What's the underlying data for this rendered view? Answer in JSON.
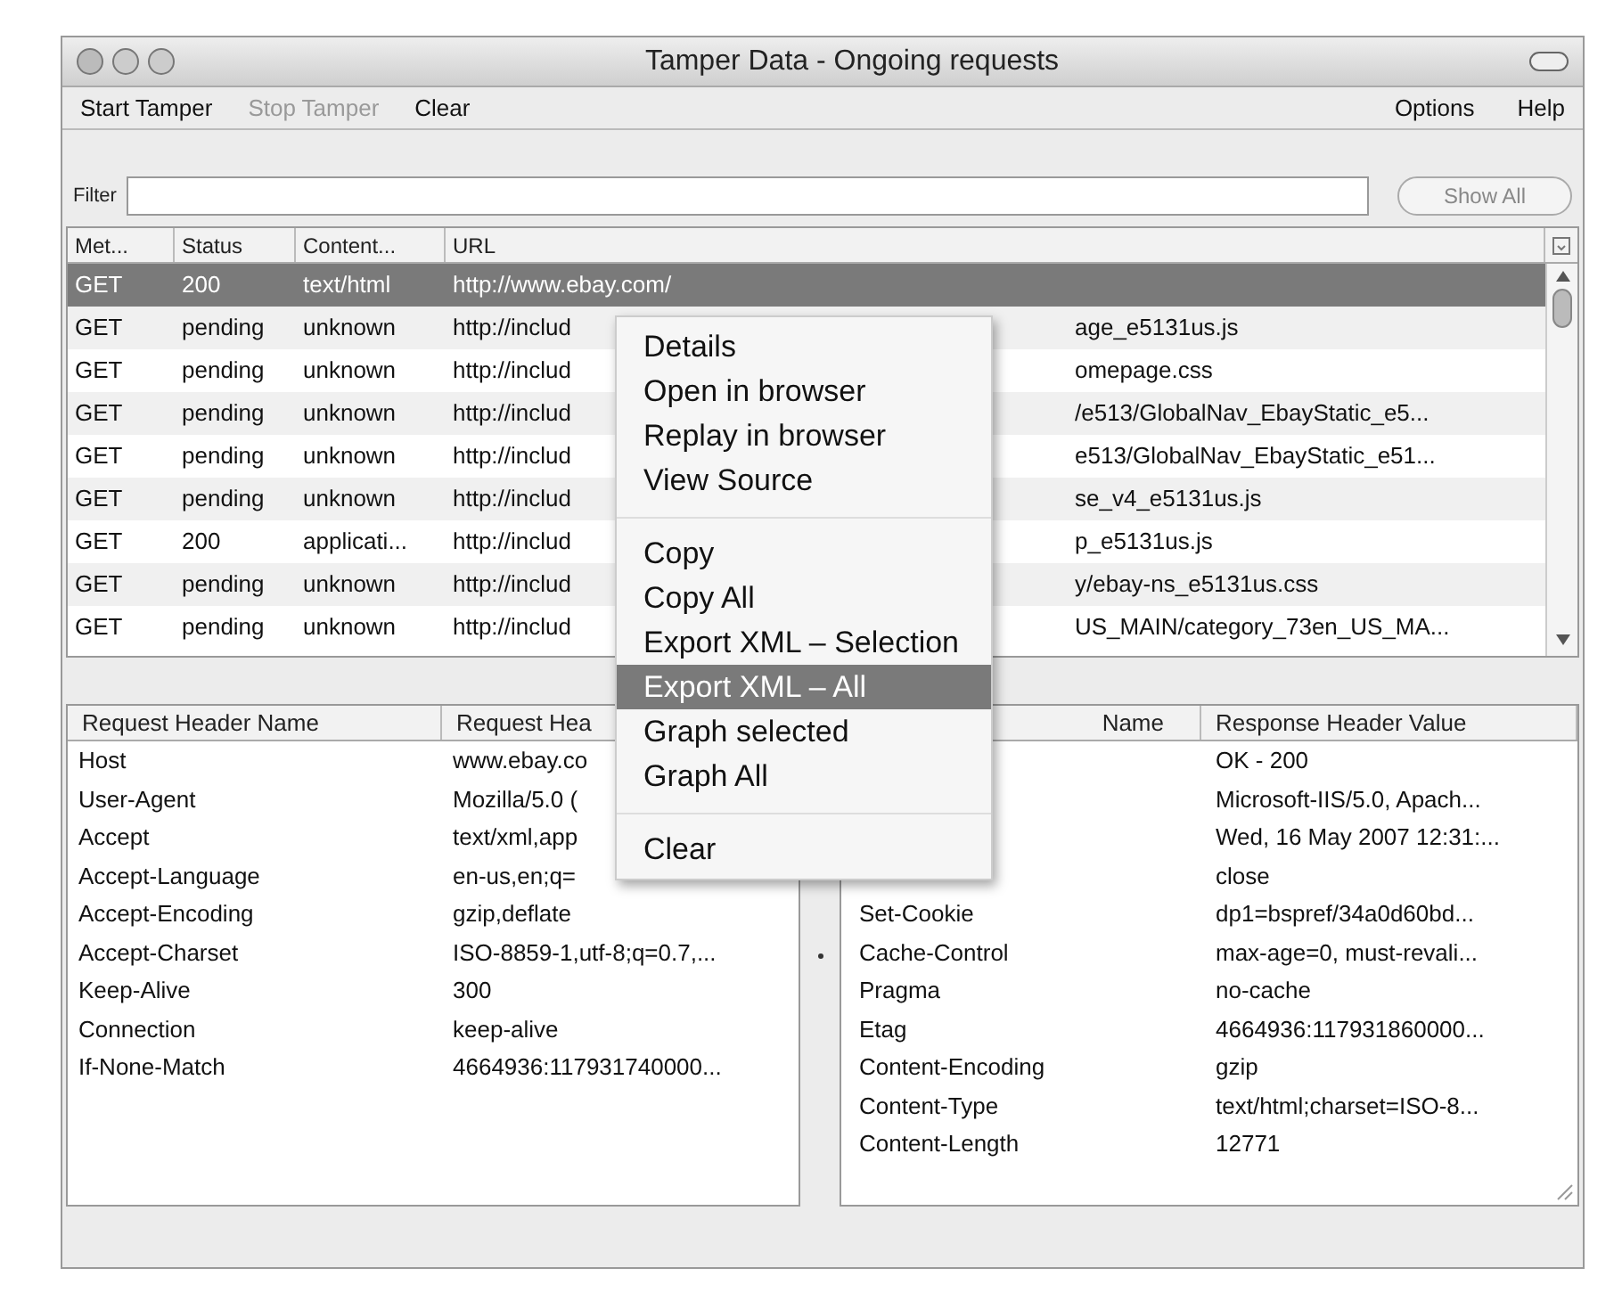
{
  "window": {
    "title": "Tamper Data - Ongoing requests"
  },
  "toolbar": [
    {
      "label": "Start Tamper",
      "disabled": false
    },
    {
      "label": "Stop Tamper",
      "disabled": true
    },
    {
      "label": "Clear",
      "disabled": false
    }
  ],
  "menus": [
    "Options",
    "Help"
  ],
  "filter": {
    "label": "Filter",
    "button": "Show All"
  },
  "requests": {
    "columns": [
      "Met...",
      "Status",
      "Content...",
      "URL"
    ],
    "rows": [
      {
        "method": "GET",
        "status": "200",
        "content": "text/html",
        "url_start": "http://www.ebay.com/",
        "selected": true
      },
      {
        "method": "GET",
        "status": "pending",
        "content": "unknown",
        "url_start": "http://includ",
        "url_end": "age_e5131us.js",
        "selected": false
      },
      {
        "method": "GET",
        "status": "pending",
        "content": "unknown",
        "url_start": "http://includ",
        "url_end": "omepage.css",
        "selected": false
      },
      {
        "method": "GET",
        "status": "pending",
        "content": "unknown",
        "url_start": "http://includ",
        "url_end": "/e513/GlobalNav_EbayStatic_e5...",
        "selected": false
      },
      {
        "method": "GET",
        "status": "pending",
        "content": "unknown",
        "url_start": "http://includ",
        "url_end": "e513/GlobalNav_EbayStatic_e51...",
        "selected": false
      },
      {
        "method": "GET",
        "status": "pending",
        "content": "unknown",
        "url_start": "http://includ",
        "url_end": "se_v4_e5131us.js",
        "selected": false
      },
      {
        "method": "GET",
        "status": "200",
        "content": "applicati...",
        "url_start": "http://includ",
        "url_end": "p_e5131us.js",
        "selected": false
      },
      {
        "method": "GET",
        "status": "pending",
        "content": "unknown",
        "url_start": "http://includ",
        "url_end": "y/ebay-ns_e5131us.css",
        "selected": false
      },
      {
        "method": "GET",
        "status": "pending",
        "content": "unknown",
        "url_start": "http://includ",
        "url_end": "US_MAIN/category_73en_US_MA...",
        "selected": false
      }
    ]
  },
  "request_headers": {
    "columns": [
      "Request Header Name",
      "Request Hea"
    ],
    "rows": [
      {
        "name": "Host",
        "value": "www.ebay.co"
      },
      {
        "name": "User-Agent",
        "value": "Mozilla/5.0 ("
      },
      {
        "name": "Accept",
        "value": "text/xml,app"
      },
      {
        "name": "Accept-Language",
        "value": "en-us,en;q="
      },
      {
        "name": "Accept-Encoding",
        "value": "gzip,deflate"
      },
      {
        "name": "Accept-Charset",
        "value": "ISO-8859-1,utf-8;q=0.7,..."
      },
      {
        "name": "Keep-Alive",
        "value": "300"
      },
      {
        "name": "Connection",
        "value": "keep-alive"
      },
      {
        "name": "If-None-Match",
        "value": "4664936:117931740000..."
      }
    ]
  },
  "response_headers": {
    "columns": [
      "Name",
      "Response Header Value"
    ],
    "rows": [
      {
        "value": "OK - 200"
      },
      {
        "value": "Microsoft-IIS/5.0, Apach..."
      },
      {
        "value": "Wed, 16 May 2007 12:31:..."
      },
      {
        "value": "close"
      },
      {
        "name": "Set-Cookie",
        "value": "dp1=bspref/34a0d60bd..."
      },
      {
        "name": "Cache-Control",
        "value": "max-age=0, must-revali..."
      },
      {
        "name": "Pragma",
        "value": "no-cache"
      },
      {
        "name": "Etag",
        "value": "4664936:117931860000..."
      },
      {
        "name": "Content-Encoding",
        "value": "gzip"
      },
      {
        "name": "Content-Type",
        "value": "text/html;charset=ISO-8..."
      },
      {
        "name": "Content-Length",
        "value": "12771"
      }
    ]
  },
  "context_menu": [
    {
      "kind": "item",
      "label": "Details",
      "selected": false
    },
    {
      "kind": "item",
      "label": "Open in browser",
      "selected": false
    },
    {
      "kind": "item",
      "label": "Replay in browser",
      "selected": false
    },
    {
      "kind": "item",
      "label": "View Source",
      "selected": false
    },
    {
      "kind": "separator"
    },
    {
      "kind": "item",
      "label": "Copy",
      "selected": false
    },
    {
      "kind": "item",
      "label": "Copy All",
      "selected": false
    },
    {
      "kind": "item",
      "label": "Export XML – Selection",
      "selected": false
    },
    {
      "kind": "item",
      "label": "Export XML – All",
      "selected": true
    },
    {
      "kind": "item",
      "label": "Graph selected",
      "selected": false
    },
    {
      "kind": "item",
      "label": "Graph All",
      "selected": false
    },
    {
      "kind": "separator"
    },
    {
      "kind": "item",
      "label": "Clear",
      "selected": false
    }
  ]
}
